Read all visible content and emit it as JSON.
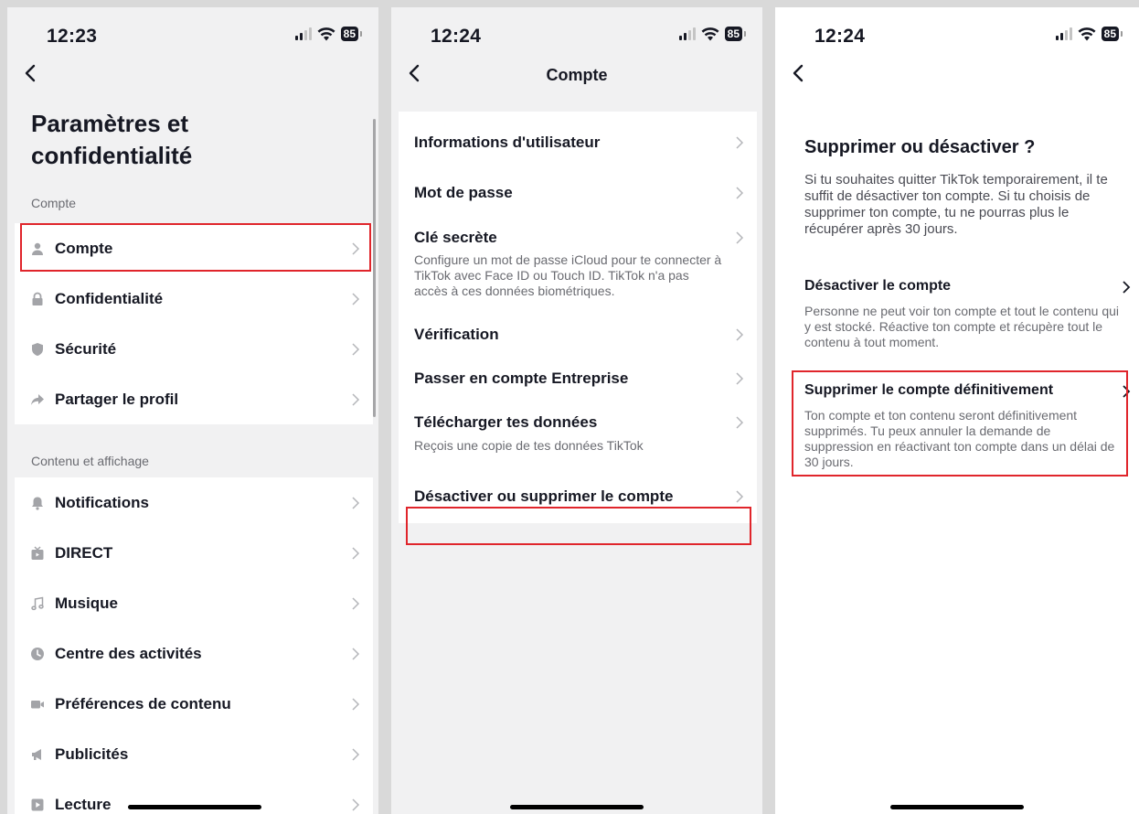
{
  "colors": {
    "highlight": "#e0252b",
    "text": "#161823",
    "muted": "#6a6b71",
    "bg": "#f1f1f2"
  },
  "panel1": {
    "time": "12:23",
    "battery": "85",
    "title": "Paramètres et confidentialité",
    "sections": [
      {
        "label": "Compte",
        "items": [
          {
            "label": "Compte",
            "icon": "person-icon"
          },
          {
            "label": "Confidentialité",
            "icon": "lock-icon"
          },
          {
            "label": "Sécurité",
            "icon": "shield-icon"
          },
          {
            "label": "Partager le profil",
            "icon": "share-icon"
          }
        ]
      },
      {
        "label": "Contenu et affichage",
        "items": [
          {
            "label": "Notifications",
            "icon": "bell-icon"
          },
          {
            "label": "DIRECT",
            "icon": "live-tv-icon"
          },
          {
            "label": "Musique",
            "icon": "music-note-icon"
          },
          {
            "label": "Centre des activités",
            "icon": "clock-icon"
          },
          {
            "label": "Préférences de contenu",
            "icon": "video-camera-icon"
          },
          {
            "label": "Publicités",
            "icon": "megaphone-icon"
          },
          {
            "label": "Lecture",
            "icon": "play-icon"
          }
        ]
      }
    ]
  },
  "panel2": {
    "time": "12:24",
    "battery": "85",
    "title": "Compte",
    "items": [
      {
        "label": "Informations d'utilisateur",
        "desc": ""
      },
      {
        "label": "Mot de passe",
        "desc": ""
      },
      {
        "label": "Clé secrète",
        "desc": "Configure un mot de passe iCloud pour te connecter à TikTok avec Face ID ou Touch ID. TikTok n'a pas accès à ces données biométriques."
      },
      {
        "label": "Vérification",
        "desc": ""
      },
      {
        "label": "Passer en compte Entreprise",
        "desc": ""
      },
      {
        "label": "Télécharger tes données",
        "desc": "Reçois une copie de tes données TikTok"
      },
      {
        "label": "Désactiver ou supprimer le compte",
        "desc": ""
      }
    ]
  },
  "panel3": {
    "time": "12:24",
    "battery": "85",
    "title": "Supprimer ou désactiver ?",
    "intro": "Si tu souhaites quitter TikTok temporairement, il te suffit de désactiver ton compte. Si tu choisis de supprimer ton compte, tu ne pourras plus le récupérer après 30 jours.",
    "options": [
      {
        "title": "Désactiver le compte",
        "desc": "Personne ne peut voir ton compte et tout le contenu qui y est stocké. Réactive ton compte et récupère tout le contenu à tout moment."
      },
      {
        "title": "Supprimer le compte définitivement",
        "desc": "Ton compte et ton contenu seront définitivement supprimés. Tu peux annuler la demande de suppression en réactivant ton compte dans un délai de 30 jours."
      }
    ]
  }
}
